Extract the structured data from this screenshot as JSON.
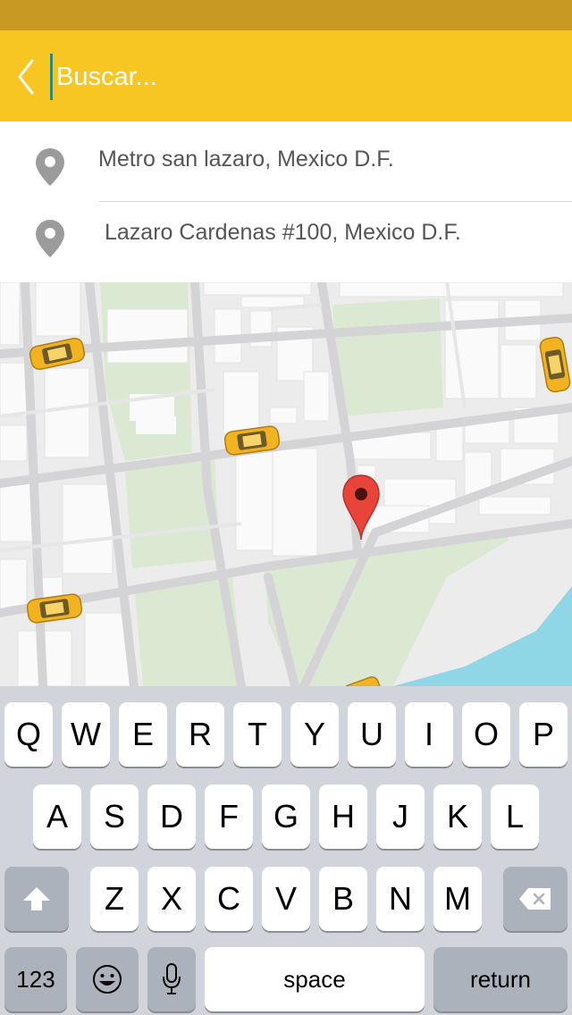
{
  "search": {
    "placeholder": "Buscar..."
  },
  "results": [
    {
      "label": "Metro san lazaro, Mexico D.F."
    },
    {
      "label": "Lazaro Cardenas #100, Mexico D.F."
    }
  ],
  "icons": {
    "back": "chevron-left-icon",
    "result": "location-pin-icon",
    "map_pin": "map-marker-icon",
    "taxi": "taxi-icon"
  },
  "colors": {
    "header": "#f8c623",
    "status_bar": "#c99a22",
    "map_pin": "#e8443a",
    "taxi": "#f2b321",
    "water": "#8fd6e6",
    "park": "#dbe9d2"
  },
  "keyboard": {
    "row1": [
      "Q",
      "W",
      "E",
      "R",
      "T",
      "Y",
      "U",
      "I",
      "O",
      "P"
    ],
    "row2": [
      "A",
      "S",
      "D",
      "F",
      "G",
      "H",
      "J",
      "K",
      "L"
    ],
    "row3": [
      "Z",
      "X",
      "C",
      "V",
      "B",
      "N",
      "M"
    ],
    "numbers": "123",
    "space": "space",
    "return": "return"
  }
}
